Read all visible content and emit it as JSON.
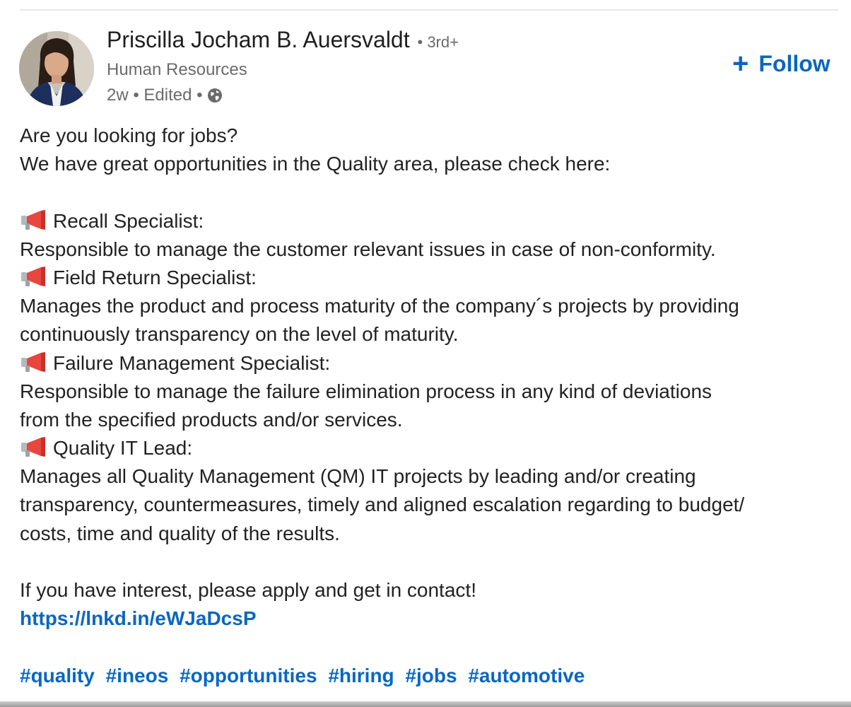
{
  "post": {
    "author": {
      "name": "Priscilla Jocham B. Auersvaldt",
      "degree": "• 3rd+",
      "headline": "Human Resources",
      "meta": "2w • Edited •"
    },
    "follow": {
      "label": "Follow",
      "icon": "plus-icon",
      "color": "#0a66c2"
    },
    "body": {
      "intro": [
        "Are you looking for jobs?",
        "We have great opportunities in the Quality area, please check here:"
      ],
      "jobs": [
        {
          "icon": "megaphone-icon",
          "title": "Recall Specialist:",
          "description": [
            "Responsible to manage the customer relevant issues in case of non-conformity."
          ]
        },
        {
          "icon": "megaphone-icon",
          "title": "Field Return Specialist:",
          "description": [
            "Manages the product and process maturity of the company´s projects by providing",
            "continuously transparency on the level of maturity."
          ]
        },
        {
          "icon": "megaphone-icon",
          "title": "Failure Management Specialist:",
          "description": [
            "Responsible to manage the failure elimination process in any kind of deviations",
            "from the specified products and/or services."
          ]
        },
        {
          "icon": "megaphone-icon",
          "title": "Quality IT Lead:",
          "description": [
            "Manages all Quality Management (QM) IT projects by leading and/or creating",
            "transparency, countermeasures, timely and aligned escalation regarding to budget/",
            "costs, time and quality of the results."
          ]
        }
      ],
      "closing": "If you have interest, please apply and get in contact!",
      "link": "https://lnkd.in/eWJaDcsP",
      "hashtags": [
        "#quality",
        "#ineos",
        "#opportunities",
        "#hiring",
        "#jobs",
        "#automotive"
      ]
    }
  },
  "colors": {
    "link": "#0a66c2",
    "text": "#222222",
    "muted": "#6b6b6b"
  }
}
